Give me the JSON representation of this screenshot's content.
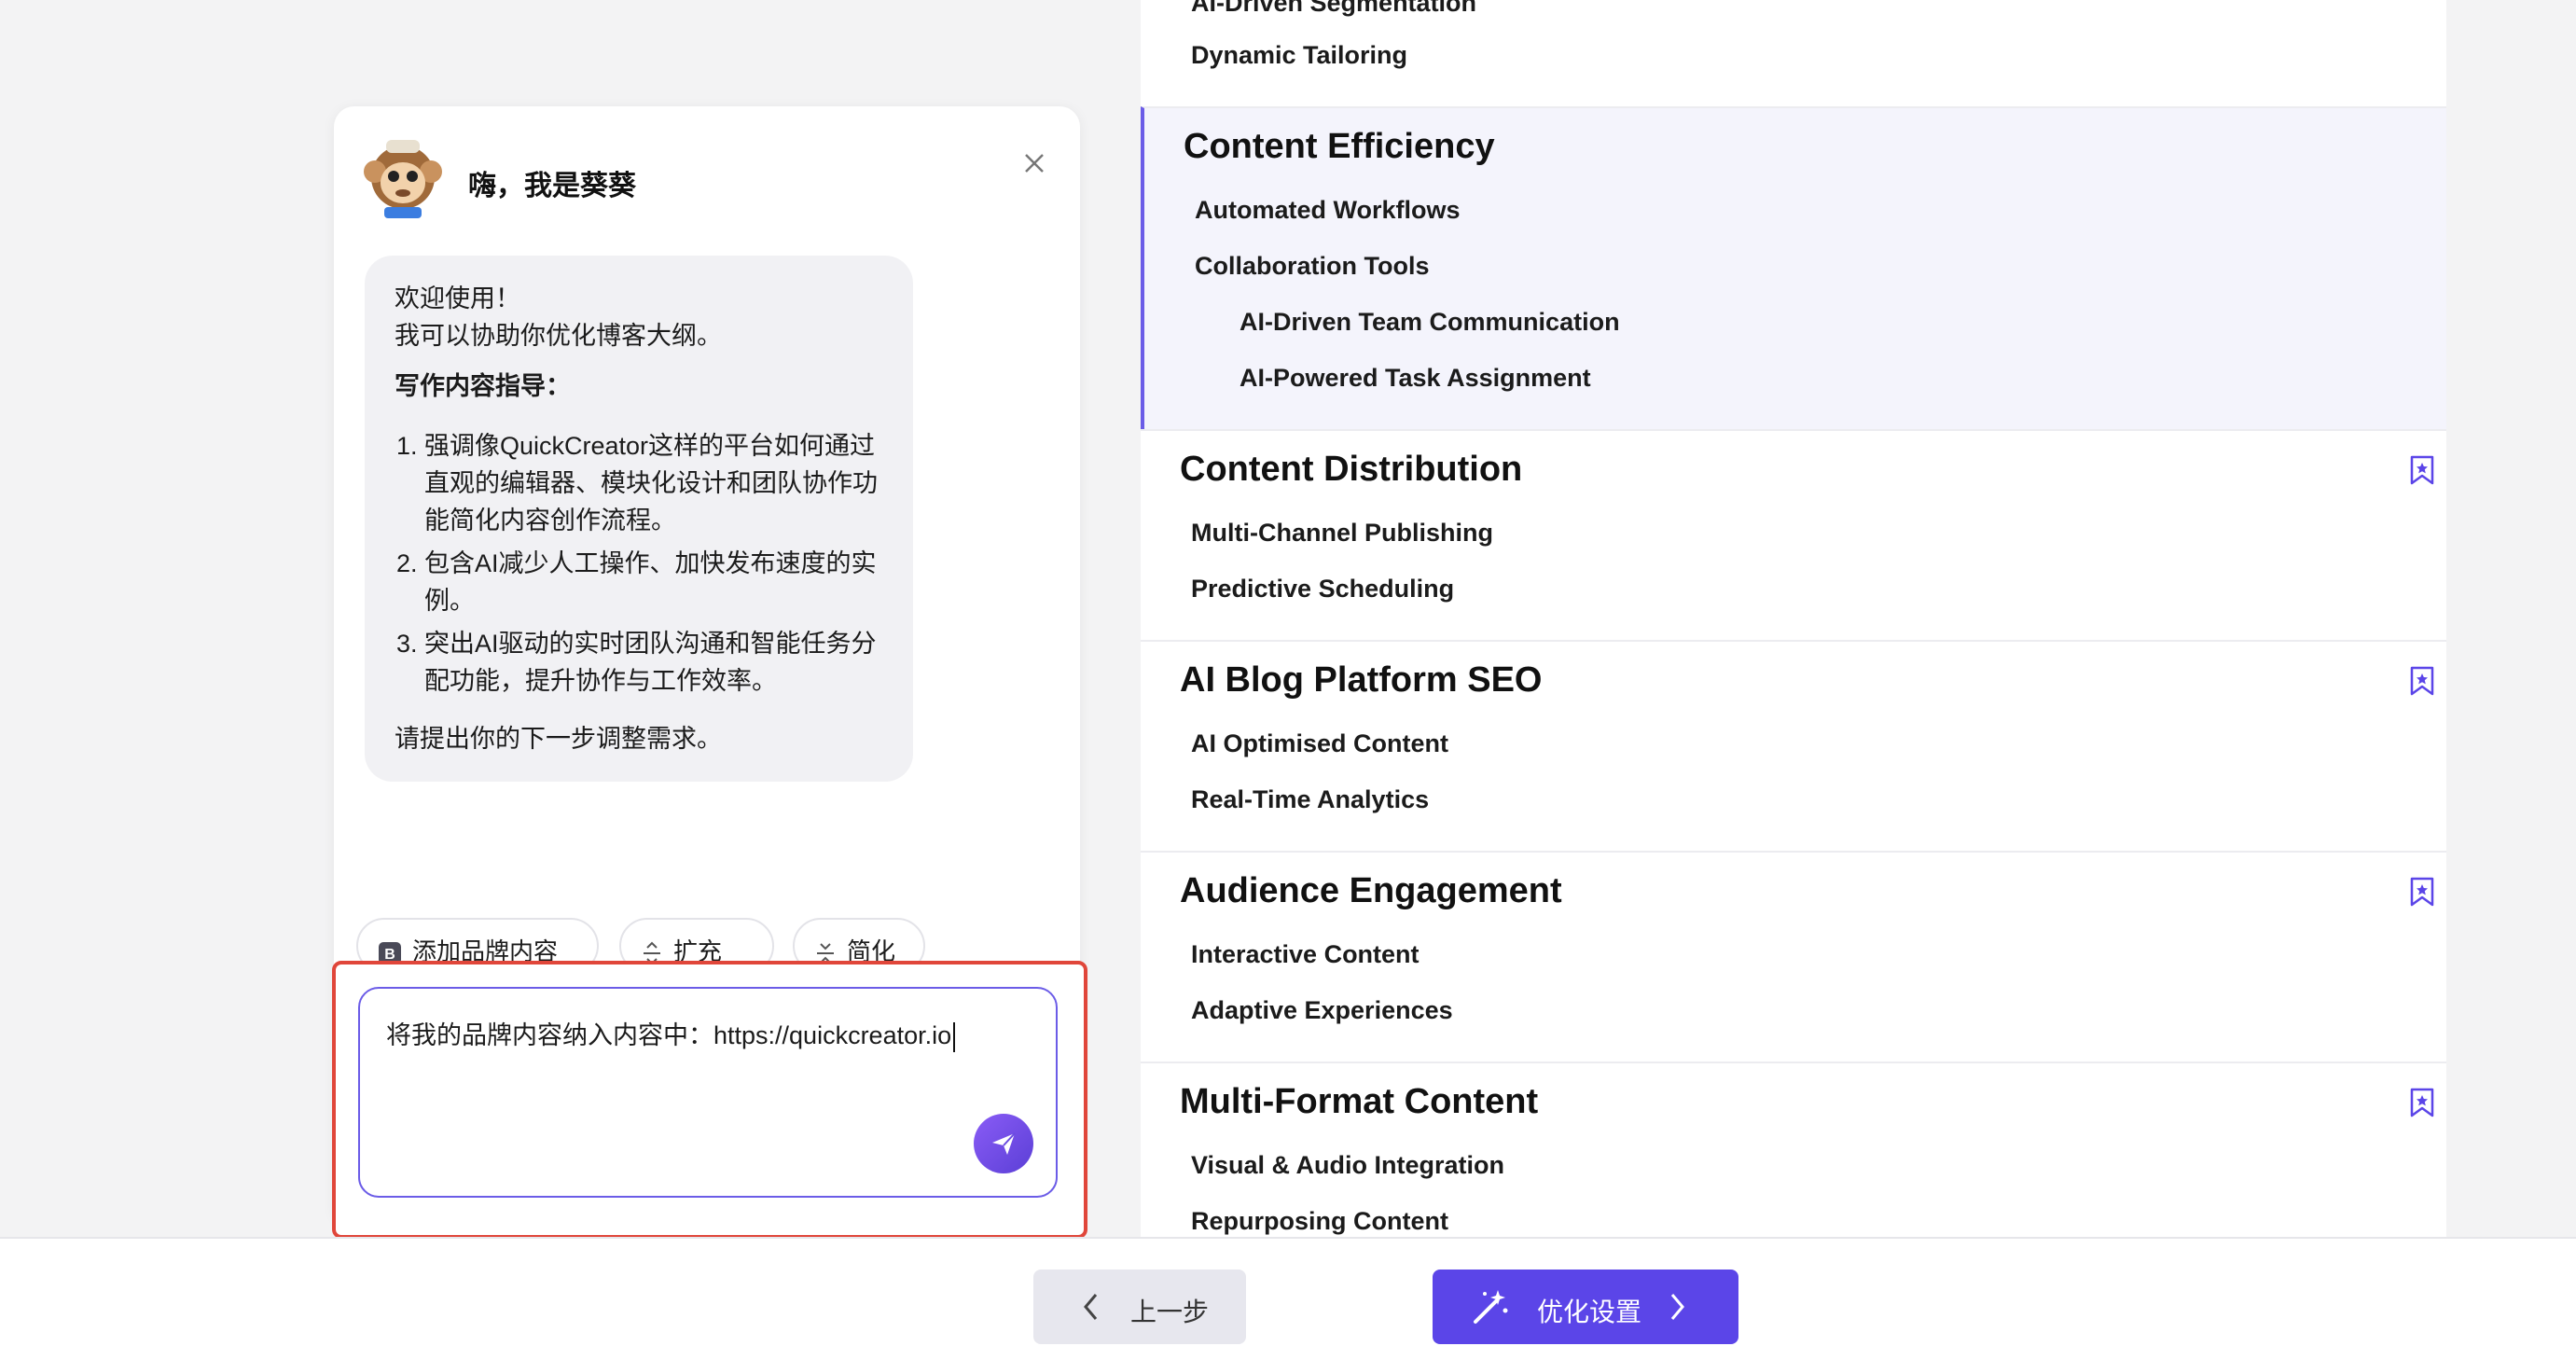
{
  "chat": {
    "title": "嗨，我是葵葵",
    "welcome_line1": "欢迎使用！",
    "welcome_line2": "我可以协助你优化博客大纲。",
    "guide_heading": "写作内容指导：",
    "guide_items": [
      "强调像QuickCreator这样的平台如何通过直观的编辑器、模块化设计和团队协作功能简化内容创作流程。",
      "包含AI减少人工操作、加快发布速度的实例。",
      "突出AI驱动的实时团队沟通和智能任务分配功能，提升协作与工作效率。"
    ],
    "closing": "请提出你的下一步调整需求。",
    "actions": {
      "brand": "添加品牌内容",
      "expand": "扩充",
      "simplify": "简化"
    },
    "input_value": "将我的品牌内容纳入内容中：https://quickcreator.io"
  },
  "outline": {
    "top_partial": {
      "cut_item": "AI-Driven Segmentation",
      "item": "Dynamic Tailoring"
    },
    "sections": [
      {
        "title": "Content Efficiency",
        "items": [
          "Automated Workflows",
          "Collaboration Tools"
        ],
        "subitems": [
          "AI-Driven Team Communication",
          "AI-Powered Task Assignment"
        ]
      },
      {
        "title": "Content Distribution",
        "items": [
          "Multi-Channel Publishing",
          "Predictive Scheduling"
        ]
      },
      {
        "title": "AI Blog Platform SEO",
        "items": [
          "AI Optimised Content",
          "Real-Time Analytics"
        ]
      },
      {
        "title": "Audience Engagement",
        "items": [
          "Interactive Content",
          "Adaptive Experiences"
        ]
      },
      {
        "title": "Multi-Format Content",
        "items": [
          "Visual & Audio Integration",
          "Repurposing Content"
        ]
      }
    ]
  },
  "footer": {
    "prev_label": "上一步",
    "next_label": "优化设置"
  },
  "colors": {
    "accent": "#5b45e8",
    "highlight_border": "#e0463a",
    "active_bg": "#f4f4fc"
  }
}
